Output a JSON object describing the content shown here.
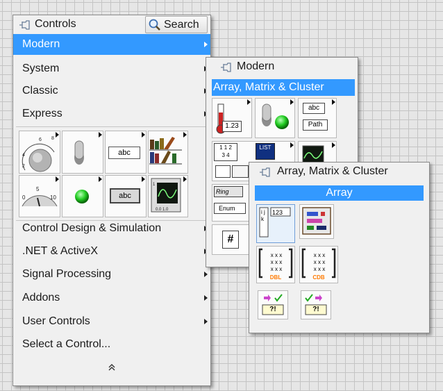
{
  "controls_palette": {
    "title": "Controls",
    "search_label": "Search",
    "items": [
      {
        "label": "Modern",
        "selected": true,
        "submenu": true
      },
      {
        "label": "System",
        "submenu": true
      },
      {
        "label": "Classic",
        "submenu": true
      },
      {
        "label": "Express",
        "submenu": true
      }
    ],
    "icon_labels": {
      "string_control": "abc",
      "string_indicator": "abc"
    },
    "items_bottom": [
      {
        "label": "Control Design & Simulation",
        "submenu": true
      },
      {
        "label": ".NET & ActiveX",
        "submenu": true
      },
      {
        "label": "Signal Processing",
        "submenu": true
      },
      {
        "label": "Addons",
        "submenu": true
      },
      {
        "label": "User Controls",
        "submenu": true
      },
      {
        "label": "Select a Control...",
        "submenu": false
      }
    ],
    "collapse_glyph": "≈"
  },
  "modern_palette": {
    "title": "Modern",
    "selected_label": "Array, Matrix & Cluster",
    "icon_labels": {
      "numeric": "1.23",
      "string": "abc",
      "path": "Path",
      "list": "LIST",
      "ring": "Ring",
      "enum": "Enum",
      "refnum": "#",
      "grid_a": "1 1 2",
      "grid_b": "3 4"
    }
  },
  "array_palette": {
    "title": "Array, Matrix & Cluster",
    "header_label": "Array",
    "icon_labels": {
      "array_index": "123",
      "ijk": "i j k",
      "matrix_dbl": "DBL",
      "matrix_cdb": "CDB",
      "matrix_cells": "x x x",
      "error_glyph": "?!"
    }
  },
  "colors": {
    "selection": "#3399ff",
    "panel": "#f0f0f0",
    "grid": "#c4c4c4",
    "led_green": "#22cc22"
  }
}
